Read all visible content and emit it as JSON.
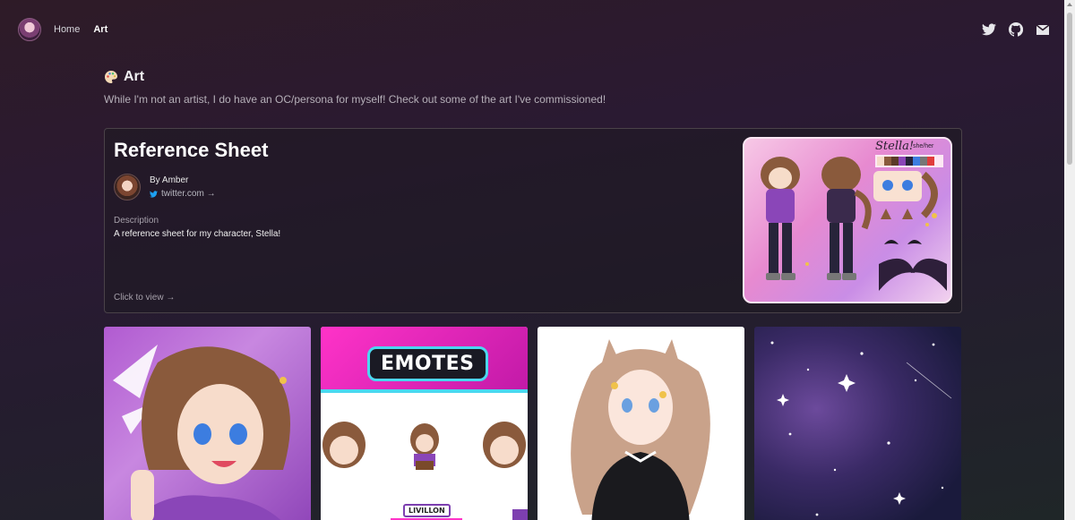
{
  "nav": {
    "links": [
      {
        "label": "Home"
      },
      {
        "label": "Art"
      }
    ],
    "icons": [
      "twitter-icon",
      "github-icon",
      "mail-icon"
    ]
  },
  "header": {
    "title": "Art",
    "subtitle": "While I'm not an artist, I do have an OC/persona for myself! Check out some of the art I've commissioned!"
  },
  "featured": {
    "title": "Reference Sheet",
    "author": "By Amber",
    "author_link": "twitter.com →",
    "description_label": "Description",
    "description": "A reference sheet for my character, Stella!",
    "cta": "Click to view →",
    "image_texts": [
      "Stella!",
      "she/her"
    ]
  },
  "gallery": {
    "emotes_label": "EMOTES",
    "liv_label": "LIVILLON"
  },
  "colors": {
    "twitter_blue": "#1da1f2",
    "emote_magenta": "#ff33c8"
  }
}
